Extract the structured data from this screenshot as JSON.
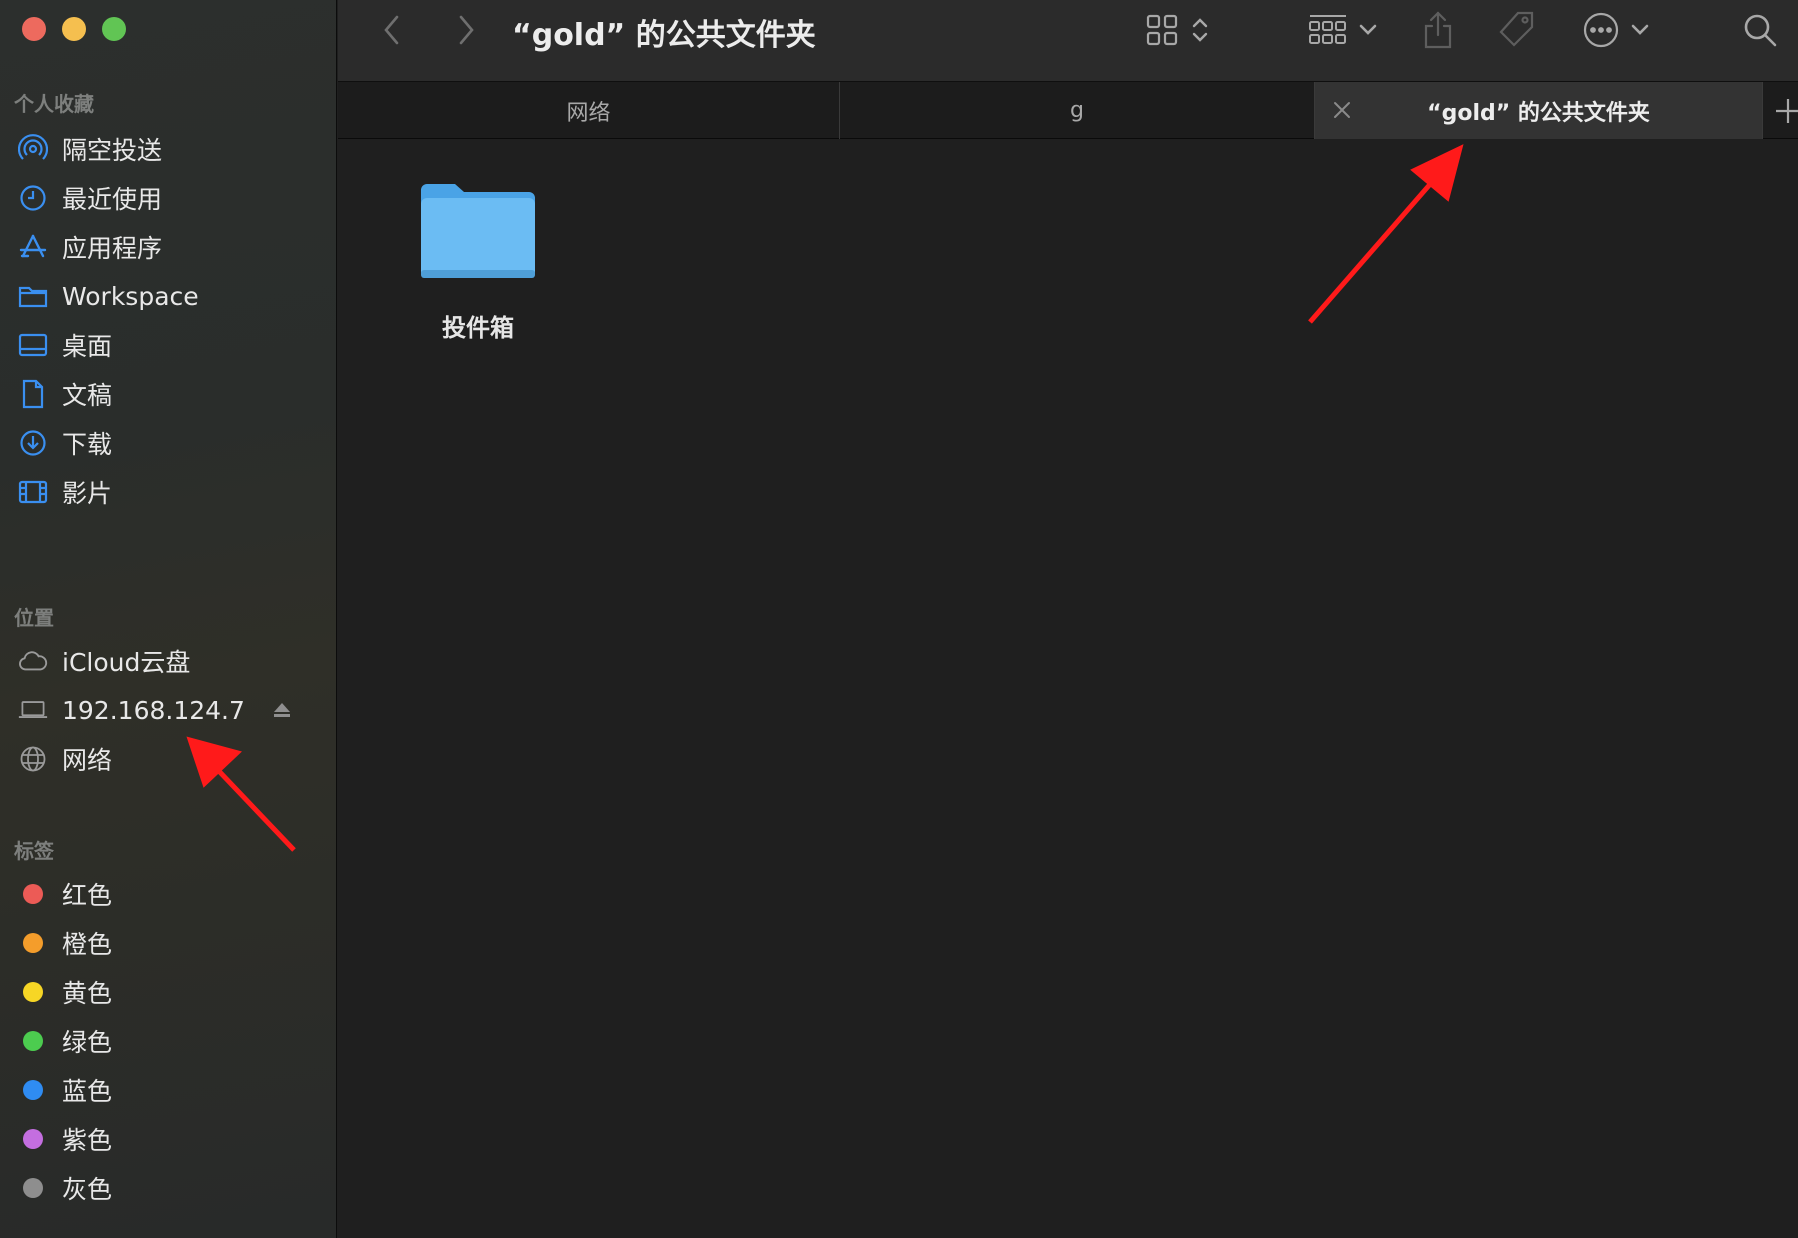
{
  "window": {
    "title": "“gold” 的公共文件夹"
  },
  "sidebar": {
    "favorites_title": "个人收藏",
    "favorites": [
      {
        "label": "隔空投送",
        "icon": "airdrop-icon"
      },
      {
        "label": "最近使用",
        "icon": "clock-icon"
      },
      {
        "label": "应用程序",
        "icon": "applications-icon"
      },
      {
        "label": "Workspace",
        "icon": "folder-icon"
      },
      {
        "label": "桌面",
        "icon": "desktop-icon"
      },
      {
        "label": "文稿",
        "icon": "document-icon"
      },
      {
        "label": "下载",
        "icon": "download-icon"
      },
      {
        "label": "影片",
        "icon": "film-icon"
      }
    ],
    "locations_title": "位置",
    "locations": [
      {
        "label": "iCloud云盘",
        "icon": "cloud-icon"
      },
      {
        "label": "192.168.124.7",
        "icon": "laptop-icon",
        "ejectable": true
      },
      {
        "label": "网络",
        "icon": "globe-icon"
      }
    ],
    "tags_title": "标签",
    "tags": [
      {
        "label": "红色",
        "color": "#ec5b56"
      },
      {
        "label": "橙色",
        "color": "#f49d2b"
      },
      {
        "label": "黄色",
        "color": "#f7d625"
      },
      {
        "label": "绿色",
        "color": "#4ccc4f"
      },
      {
        "label": "蓝色",
        "color": "#2f8cf2"
      },
      {
        "label": "紫色",
        "color": "#c46ee0"
      },
      {
        "label": "灰色",
        "color": "#8e8e8e"
      }
    ]
  },
  "toolbar": {
    "back_icon": "chevron-left-icon",
    "forward_icon": "chevron-right-icon",
    "view_icon": "grid-view-icon",
    "group_icon": "group-icon",
    "share_icon": "share-icon",
    "tag_icon": "tag-icon",
    "more_icon": "ellipsis-circle-icon",
    "search_icon": "search-icon"
  },
  "tabs": [
    {
      "label": "网络",
      "active": false
    },
    {
      "label": "g",
      "active": false
    },
    {
      "label": "“gold” 的公共文件夹",
      "active": true
    }
  ],
  "content": {
    "items": [
      {
        "name": "投件箱",
        "type": "folder"
      }
    ]
  },
  "colors": {
    "accent": "#3a8ff0",
    "folder": "#6bbcf3",
    "annotation_arrow": "#ff1a1a"
  }
}
